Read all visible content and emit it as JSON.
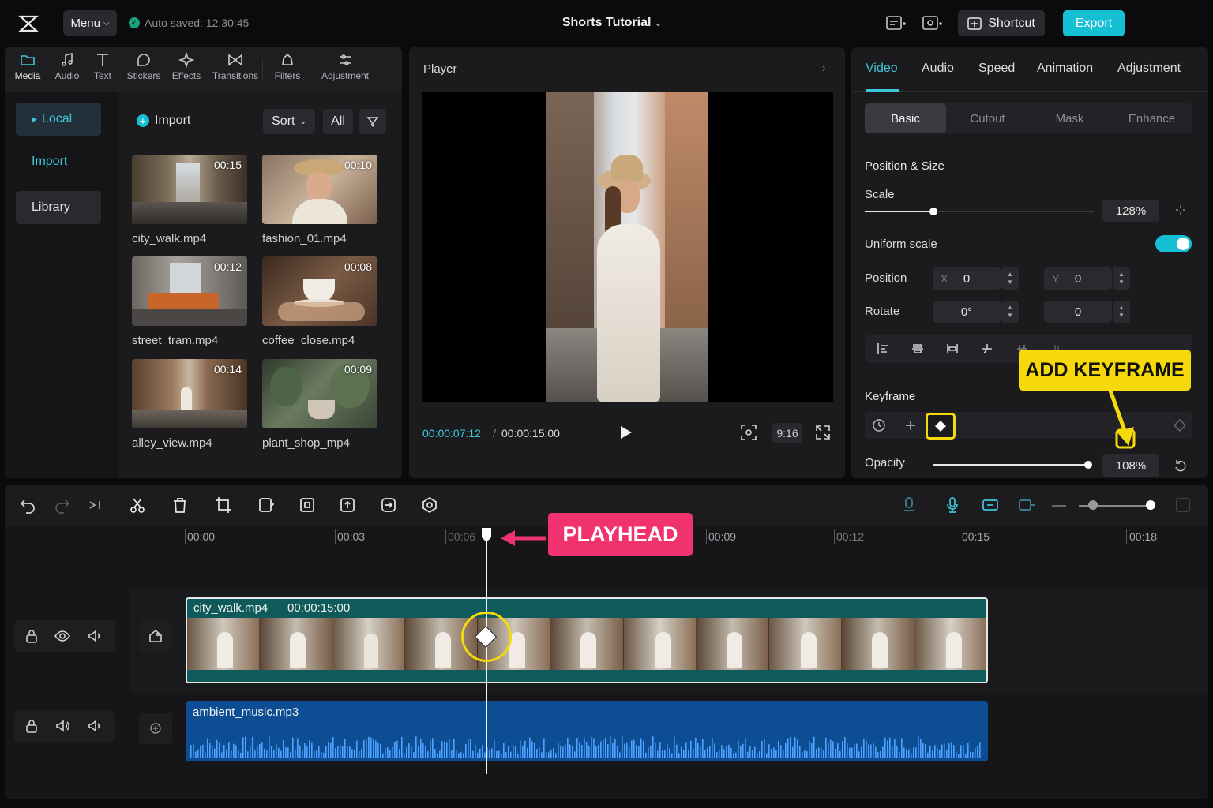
{
  "topbar": {
    "menu_label": "Menu",
    "autosave": "Auto saved: 12:30:45",
    "project_title": "Shorts Tutorial",
    "shortcut_label": "Shortcut",
    "export_label": "Export"
  },
  "tool_tabs": [
    {
      "label": "Media",
      "icon": "folder-icon"
    },
    {
      "label": "Audio",
      "icon": "music-note-icon"
    },
    {
      "label": "Text",
      "icon": "text-icon"
    },
    {
      "label": "Stickers",
      "icon": "sticker-icon"
    },
    {
      "label": "Effects",
      "icon": "sparkle-icon"
    },
    {
      "label": "Transitions",
      "icon": "transition-icon"
    },
    {
      "label": "Filters",
      "icon": "filter-icon"
    },
    {
      "label": "Adjustment",
      "icon": "sliders-icon"
    }
  ],
  "side_nav": {
    "local": "Local",
    "import": "Import",
    "library": "Library"
  },
  "media": {
    "import_label": "Import",
    "sort_label": "Sort",
    "all_label": "All",
    "items": [
      {
        "name": "city_walk.mp4",
        "duration": "00:15"
      },
      {
        "name": "fashion_01.mp4",
        "duration": "00:10"
      },
      {
        "name": "street_tram.mp4",
        "duration": "00:12"
      },
      {
        "name": "coffee_close.mp4",
        "duration": "00:08"
      },
      {
        "name": "alley_view.mp4",
        "duration": "00:14"
      },
      {
        "name": "plant_shop_mp4",
        "duration": "00:09"
      }
    ]
  },
  "player": {
    "title": "Player",
    "current_time": "00:00:07:12",
    "separator": "/",
    "total_time": "00:00:15:00",
    "ratio": "9:16"
  },
  "inspector": {
    "tabs": [
      "Video",
      "Audio",
      "Speed",
      "Animation",
      "Adjustment"
    ],
    "sub_tabs": [
      "Basic",
      "Cutout",
      "Mask",
      "Enhance"
    ],
    "position_size_title": "Position & Size",
    "scale_label": "Scale",
    "scale_value": "128%",
    "uniform_scale_label": "Uniform scale",
    "position_label": "Position",
    "pos_x_axis": "X",
    "pos_x": "0",
    "pos_y_axis": "Y",
    "pos_y": "0",
    "rotate_label": "Rotate",
    "rotate_value": "0°",
    "rotate_value_2": "0",
    "keyframe_label": "Keyframe",
    "opacity_label": "Opacity",
    "opacity_value": "108%",
    "scale_fraction": 0.3,
    "opacity_fraction": 1.0
  },
  "callouts": {
    "add_keyframe": "ADD KEYFRAME",
    "playhead": "PLAYHEAD"
  },
  "timeline": {
    "ruler": [
      "00:00",
      "00:03",
      "00:06",
      "00:09",
      "00:12",
      "00:15",
      "00:18"
    ],
    "video_clip_name": "city_walk.mp4",
    "video_clip_duration": "00:00:15:00",
    "audio_clip_name": "ambient_music.mp3"
  },
  "colors": {
    "accent": "#15bfd4",
    "highlight_yellow": "#f5d90a",
    "playhead_pink": "#f0336e",
    "video_track": "#0f5a5a",
    "audio_track": "#0d4d94"
  }
}
